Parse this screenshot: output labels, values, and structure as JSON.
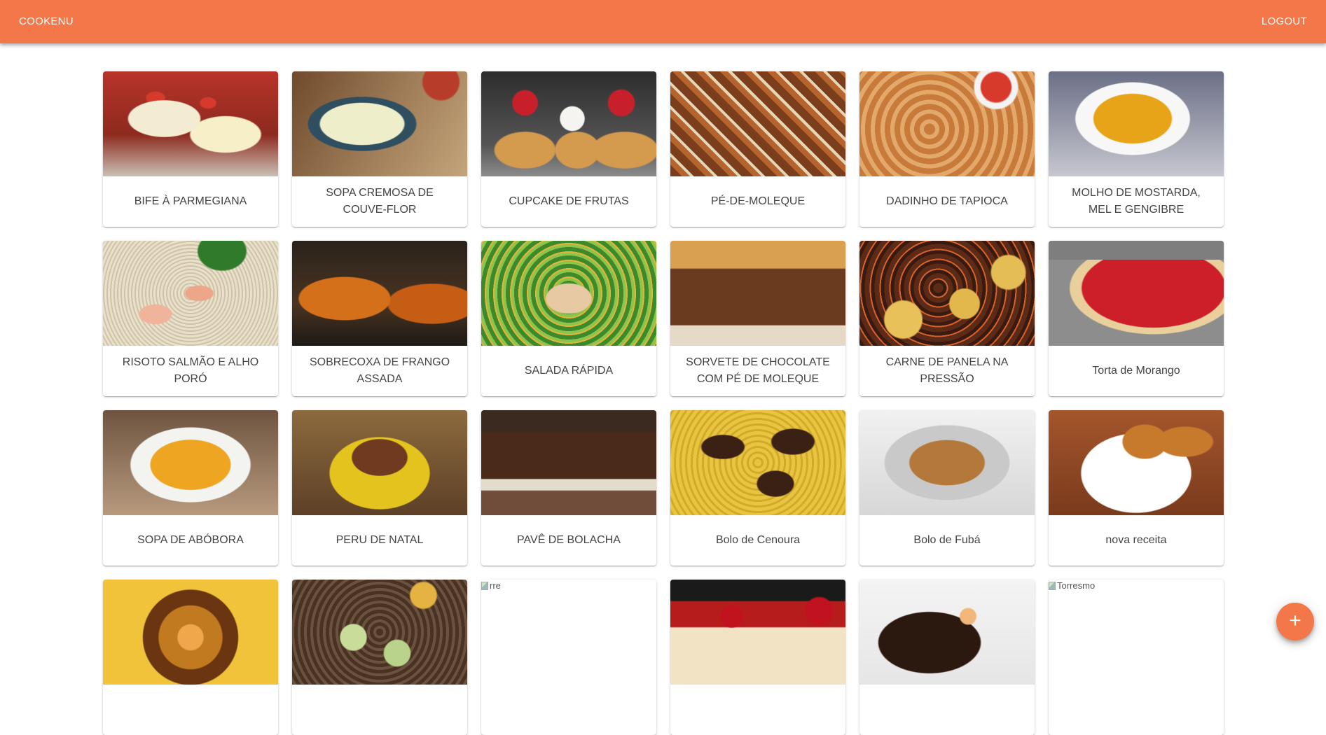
{
  "header": {
    "brand": "COOKENU",
    "logout_label": "LOGOUT",
    "background_color": "#f4774a"
  },
  "recipes": [
    {
      "title": "BIFE À PARMEGIANA"
    },
    {
      "title": "SOPA CREMOSA DE COUVE-FLOR"
    },
    {
      "title": "CUPCAKE DE FRUTAS"
    },
    {
      "title": "PÉ-DE-MOLEQUE"
    },
    {
      "title": "DADINHO DE TAPIOCA"
    },
    {
      "title": "MOLHO DE MOSTARDA, MEL E GENGIBRE"
    },
    {
      "title": "RISOTO SALMÃO E ALHO PORÓ"
    },
    {
      "title": "SOBRECOXA DE FRANGO ASSADA"
    },
    {
      "title": "SALADA RÁPIDA"
    },
    {
      "title": "SORVETE DE CHOCOLATE COM PÉ DE MOLEQUE"
    },
    {
      "title": "CARNE DE PANELA NA PRESSÃO"
    },
    {
      "title": "Torta de Morango"
    },
    {
      "title": "SOPA DE ABÓBORA"
    },
    {
      "title": "PERU DE NATAL"
    },
    {
      "title": "PAVÊ DE BOLACHA"
    },
    {
      "title": "Bolo de Cenoura"
    },
    {
      "title": "Bolo de Fubá"
    },
    {
      "title": "nova receita"
    },
    {
      "title": ""
    },
    {
      "title": ""
    },
    {
      "title": "",
      "broken_image_alt": "rre"
    },
    {
      "title": ""
    },
    {
      "title": ""
    },
    {
      "title": "",
      "broken_image_alt": "Torresmo"
    }
  ],
  "fab": {
    "label": "+",
    "icon": "plus-icon"
  }
}
